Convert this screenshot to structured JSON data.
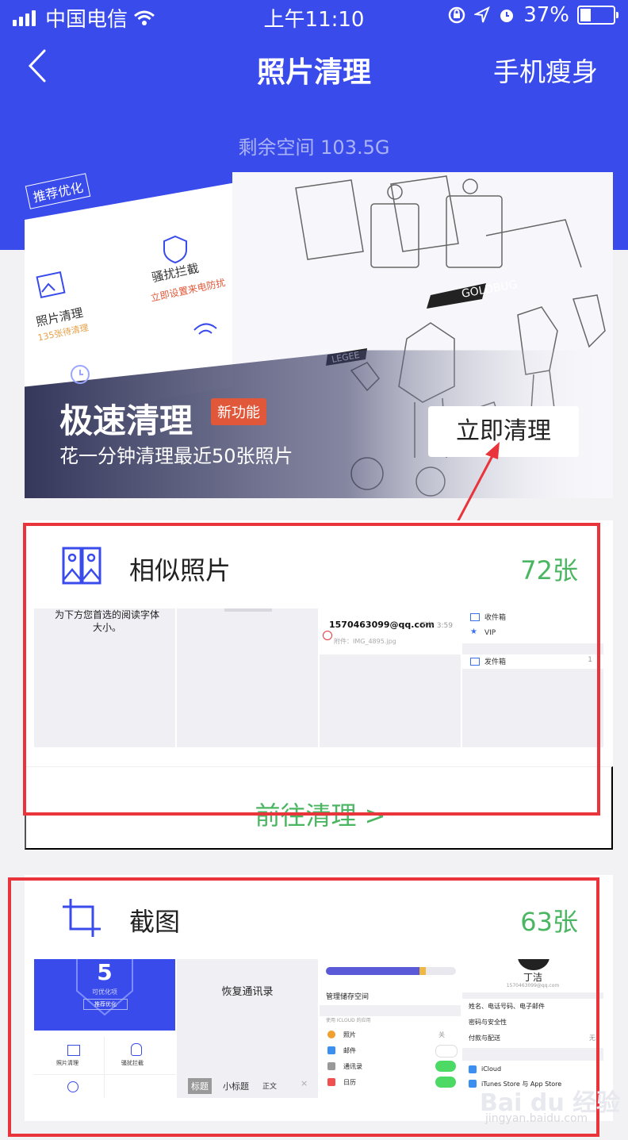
{
  "status": {
    "carrier": "中国电信",
    "time": "上午11:10",
    "battery": "37%",
    "battery_level": 0.37
  },
  "nav": {
    "title": "照片清理",
    "right_action": "手机瘦身"
  },
  "storage": {
    "text": "剩余空间 103.5G"
  },
  "banner": {
    "tag": "推荐优化",
    "title": "极速清理",
    "badge": "新功能",
    "subtitle": "花一分钟清理最近50张照片",
    "button": "立即清理",
    "mini": {
      "harass_title": "骚扰拦截",
      "harass_sub": "立即设置来电防扰",
      "photo_title": "照片清理",
      "photo_sub": "135张待清理",
      "goldbug": "GOLDBUG",
      "legee": "LEGEE"
    }
  },
  "similar": {
    "label": "相似照片",
    "count": "72张",
    "action": "前往清理 >",
    "thumbs": {
      "t1": "为下方您首选的阅读字体大小。",
      "t3_email": "1570463099@qq.com",
      "t3_time": "下午 3:59",
      "t3_attach": "附件：IMG_4895.jpg",
      "t4_inbox": "收件箱",
      "t4_vip": "VIP",
      "t4_sent": "发件箱",
      "t4_count": "1"
    }
  },
  "screenshots": {
    "label": "截图",
    "count": "63张",
    "thumbs": {
      "a_num": "5",
      "a_sub": "可优化项",
      "a_btn": "推荐优化",
      "a_i1": "照片清理",
      "a_i2": "骚扰拦截",
      "b_title": "恢复通讯录",
      "b_t1": "标题",
      "b_t2": "小标题",
      "b_t3": "正文",
      "c_manage": "管理储存空间",
      "c_section": "使用 ICLOUD 的应用",
      "c_r1": "照片",
      "c_r1v": "关",
      "c_r2": "邮件",
      "c_r3": "通讯录",
      "c_r4": "日历",
      "d_name": "丁洁",
      "d_email": "1570463099@qq.com",
      "d_r1": "姓名、电话号码、电子邮件",
      "d_r2": "密码与安全性",
      "d_r3": "付款与配送",
      "d_r3v": "无",
      "d_r4": "iCloud",
      "d_r5": "iTunes Store 与 App Store"
    }
  },
  "watermark": {
    "brand": "Bai du 经验",
    "url": "jingyan.baidu.com"
  },
  "colors": {
    "primary": "#3a4bec",
    "count_green": "#4bb662",
    "highlight_red": "#e8343a",
    "badge_red": "#e0573a"
  }
}
